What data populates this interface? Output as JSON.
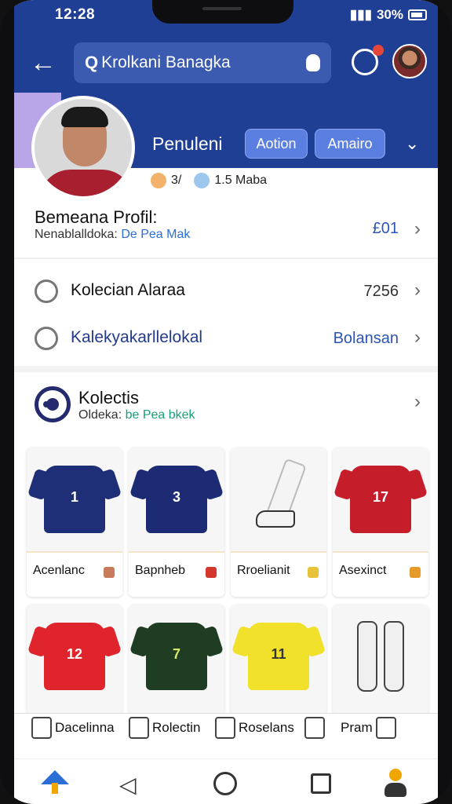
{
  "status": {
    "time": "12:28",
    "battery": "30%"
  },
  "header": {
    "search_text": "Krolkani Banagka"
  },
  "profile": {
    "name": "Penuleni",
    "action_button": "Aotion",
    "second_button": "Amairo",
    "stat_a": "3/",
    "stat_b": "1.5 Maba"
  },
  "section": {
    "title": "Bemeana Profil:",
    "sub_label": "Nenablalldoka:",
    "sub_highlight": "De Pea Mak",
    "value": "£01"
  },
  "rows": [
    {
      "label": "Kolecian Alaraa",
      "value": "7256"
    },
    {
      "label": "Kalekyakarllelokal",
      "value": "Bolansan"
    }
  ],
  "collection": {
    "title": "Kolectis",
    "sub_label": "Oldeka:",
    "sub_highlight": "be Pea bkek"
  },
  "products": [
    {
      "label": "Acenlanc",
      "color": "#1e2f78",
      "number": "1"
    },
    {
      "label": "Bapnheb",
      "color": "#1c2b73",
      "number": "3"
    },
    {
      "label": "Rroelianit",
      "color": "#ffffff",
      "number": ""
    },
    {
      "label": "Asexinct",
      "color": "#c51e2a",
      "number": "17"
    },
    {
      "label": "",
      "color": "#e0242c",
      "number": "12"
    },
    {
      "label": "",
      "color": "#1f3d22",
      "number": "7"
    },
    {
      "label": "",
      "color": "#f1e12a",
      "number": "11"
    },
    {
      "label": "",
      "color": "#ffffff",
      "number": ""
    }
  ],
  "tabs": [
    {
      "label": "Dacelinna"
    },
    {
      "label": "Rolectin"
    },
    {
      "label": "Roselans"
    },
    {
      "label": ""
    },
    {
      "label": "Pram"
    }
  ]
}
